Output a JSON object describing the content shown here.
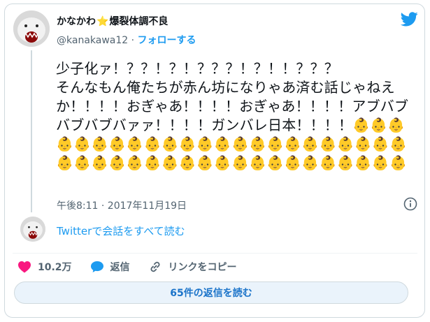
{
  "author": {
    "display_name_prefix": "かなかわ",
    "display_name_star": "⭐",
    "display_name_suffix": "爆裂体調不良",
    "handle": "@kanakawa12",
    "separator": " · ",
    "follow_label": "フォローする"
  },
  "tweet": {
    "text": "少子化ァ！？？！？！？？？！？！！？？？\nそんなもん俺たちが赤ん坊になりゃあ済む話じゃねえか！！！！おぎゃあ！！！！おぎゃあ！！！！アブバブバブバブバァァ！！！！ガンバレ日本！！！！👶👶👶👶👶👶👶👶👶👶👶👶👶👶👶👶👶👶👶👶👶👶👶👶👶👶👶👶👶👶👶👶👶👶👶👶👶👶👶👶👶👶👶",
    "timestamp": "午後8:11 · 2017年11月19日"
  },
  "thread": {
    "read_label": "Twitterで会話をすべて読む"
  },
  "actions": {
    "like_count": "10.2万",
    "reply_label": "返信",
    "copy_link_label": "リンクをコピー"
  },
  "replies_button": {
    "label": "65件の返信を読む"
  },
  "icons": {
    "brand": "twitter-bird-icon",
    "info": "info-icon",
    "like": "heart-icon",
    "reply": "speech-bubble-icon",
    "link": "link-icon"
  },
  "colors": {
    "brand_blue": "#1d9bf0",
    "like_pink": "#f91880",
    "muted": "#536471",
    "star": "#f7b500"
  }
}
